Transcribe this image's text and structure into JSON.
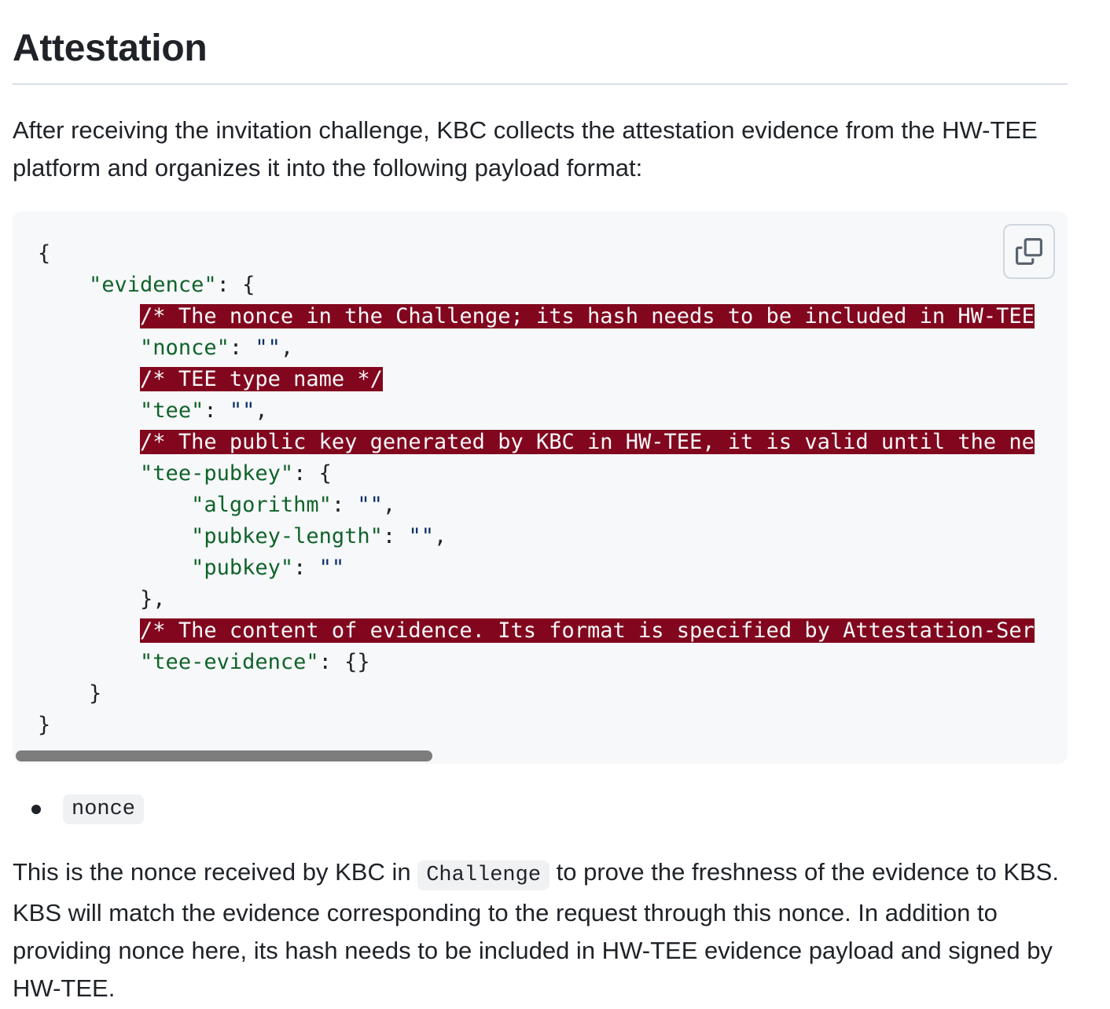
{
  "heading": "Attestation",
  "intro": "After receiving the invitation challenge, KBC collects the attestation evidence from the HW-TEE platform and organizes it into the following payload format:",
  "code": {
    "l01": "{",
    "l02_key": "\"evidence\"",
    "l02_rest": ": {",
    "l03_comment": "/* The nonce in the Challenge; its hash needs to be included in HW-TEE",
    "l04_key": "\"nonce\"",
    "l04_sep": ": ",
    "l04_val": "\"\"",
    "l04_end": ",",
    "l05_comment": "/* TEE type name */",
    "l06_key": "\"tee\"",
    "l06_sep": ": ",
    "l06_val": "\"\"",
    "l06_end": ",",
    "l07_comment": "/* The public key generated by KBC in HW-TEE, it is valid until the ne",
    "l08_key": "\"tee-pubkey\"",
    "l08_rest": ": {",
    "l09_key": "\"algorithm\"",
    "l09_sep": ": ",
    "l09_val": "\"\"",
    "l09_end": ",",
    "l10_key": "\"pubkey-length\"",
    "l10_sep": ": ",
    "l10_val": "\"\"",
    "l10_end": ",",
    "l11_key": "\"pubkey\"",
    "l11_sep": ": ",
    "l11_val": "\"\"",
    "l12": "},",
    "l13_comment": "/* The content of evidence. Its format is specified by Attestation-Ser",
    "l14_key": "\"tee-evidence\"",
    "l14_rest": ": {}",
    "l15": "}",
    "l16": "}"
  },
  "copy_icon": "copy-icon",
  "bullets": [
    "nonce"
  ],
  "body": {
    "before": "This is the nonce received by KBC in ",
    "code": "Challenge",
    "after": " to prove the freshness of the evidence to KBS. KBS will match the evidence corresponding to the request through this nonce. In addition to providing nonce here, its hash needs to be included in HW-TEE evidence payload and signed by HW-TEE."
  }
}
